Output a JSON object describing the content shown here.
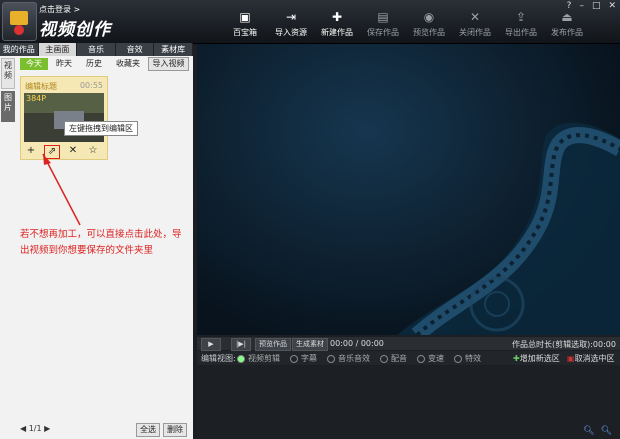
{
  "header": {
    "login_label": "点击登录 >",
    "app_title": "视频创作",
    "toolbar": [
      {
        "label": "百宝箱",
        "icon": "toolbox-icon",
        "glyph": "▣",
        "dim": false
      },
      {
        "label": "导入资源",
        "icon": "import-icon",
        "glyph": "⇥",
        "dim": false
      },
      {
        "label": "新建作品",
        "icon": "new-project-icon",
        "glyph": "✚",
        "dim": false
      },
      {
        "label": "保存作品",
        "icon": "save-icon",
        "glyph": "▤",
        "dim": true
      },
      {
        "label": "预览作品",
        "icon": "preview-eye-icon",
        "glyph": "◉",
        "dim": true
      },
      {
        "label": "关闭作品",
        "icon": "close-project-icon",
        "glyph": "✕",
        "dim": true
      },
      {
        "label": "导出作品",
        "icon": "export-icon",
        "glyph": "⇪",
        "dim": true
      },
      {
        "label": "发布作品",
        "icon": "publish-icon",
        "glyph": "⏏",
        "dim": true
      }
    ],
    "window_buttons": [
      "?",
      "–",
      "□",
      "✕"
    ]
  },
  "left_panel": {
    "main_tabs": [
      "我的作品",
      "主画面",
      "音乐",
      "音效",
      "素材库"
    ],
    "active_main_tab": 1,
    "side_tabs": [
      "视频",
      "图片"
    ],
    "sub_tabs": [
      "今天",
      "昨天",
      "历史",
      "收藏夹"
    ],
    "import_button": "导入视频",
    "clip": {
      "name": "编辑标题",
      "duration": "00:55",
      "resolution": "384P",
      "tools": [
        "+",
        "⇗",
        "✕",
        "☆"
      ]
    },
    "tooltip": "左键拖拽到编辑区",
    "annotation": "若不想再加工，可以直接点击此处，导出视频到你想要保存的文件夹里",
    "pager": "◀ 1/1 ▶",
    "select_all": "全选",
    "delete": "删除"
  },
  "controls": {
    "play": "▶",
    "step": "|▶|",
    "preview_btn": "预览作品",
    "generate_btn": "生成素材",
    "timecode": "00:00 / 00:00",
    "total_length": "作品总时长(剪辑选取):00:00",
    "edit_view_label": "编辑视图:",
    "edit_views": [
      "视频剪辑",
      "字幕",
      "音乐音效",
      "配音",
      "变速",
      "特效"
    ],
    "active_view": 0,
    "add_section": "增加新选区",
    "cancel_section": "取消选中区"
  },
  "colors": {
    "accent_green": "#7bbf2f",
    "annotation_red": "#dd2222"
  }
}
